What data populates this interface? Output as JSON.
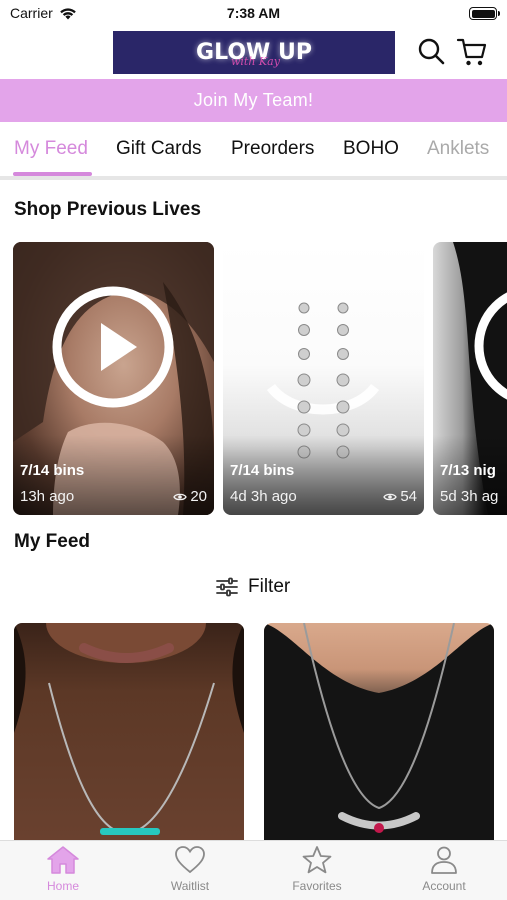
{
  "status_bar": {
    "carrier": "Carrier",
    "time": "7:38 AM"
  },
  "header": {
    "logo_text": "GLOW UP",
    "logo_script": "with Kay"
  },
  "banner": {
    "label": "Join My Team!"
  },
  "tabs": [
    {
      "label": "My Feed",
      "active": true
    },
    {
      "label": "Gift Cards",
      "active": false
    },
    {
      "label": "Preorders",
      "active": false
    },
    {
      "label": "BOHO",
      "active": false
    },
    {
      "label": "Anklets",
      "active": false
    }
  ],
  "previous_lives": {
    "title": "Shop Previous Lives",
    "items": [
      {
        "title": "7/14 bins",
        "ago": "13h ago",
        "views": "20"
      },
      {
        "title": "7/14 bins",
        "ago": "4d 3h ago",
        "views": "54"
      },
      {
        "title": "7/13 nig",
        "ago": "5d 3h ag",
        "views": ""
      }
    ]
  },
  "feed": {
    "title": "My Feed",
    "filter_label": "Filter"
  },
  "bottom_nav": [
    {
      "label": "Home",
      "icon": "home-icon",
      "active": true
    },
    {
      "label": "Waitlist",
      "icon": "heart-icon",
      "active": false
    },
    {
      "label": "Favorites",
      "icon": "star-icon",
      "active": false
    },
    {
      "label": "Account",
      "icon": "person-icon",
      "active": false
    }
  ],
  "colors": {
    "accent": "#d589dc",
    "banner": "#e3a4ea",
    "logo_bg": "#2a2668"
  }
}
